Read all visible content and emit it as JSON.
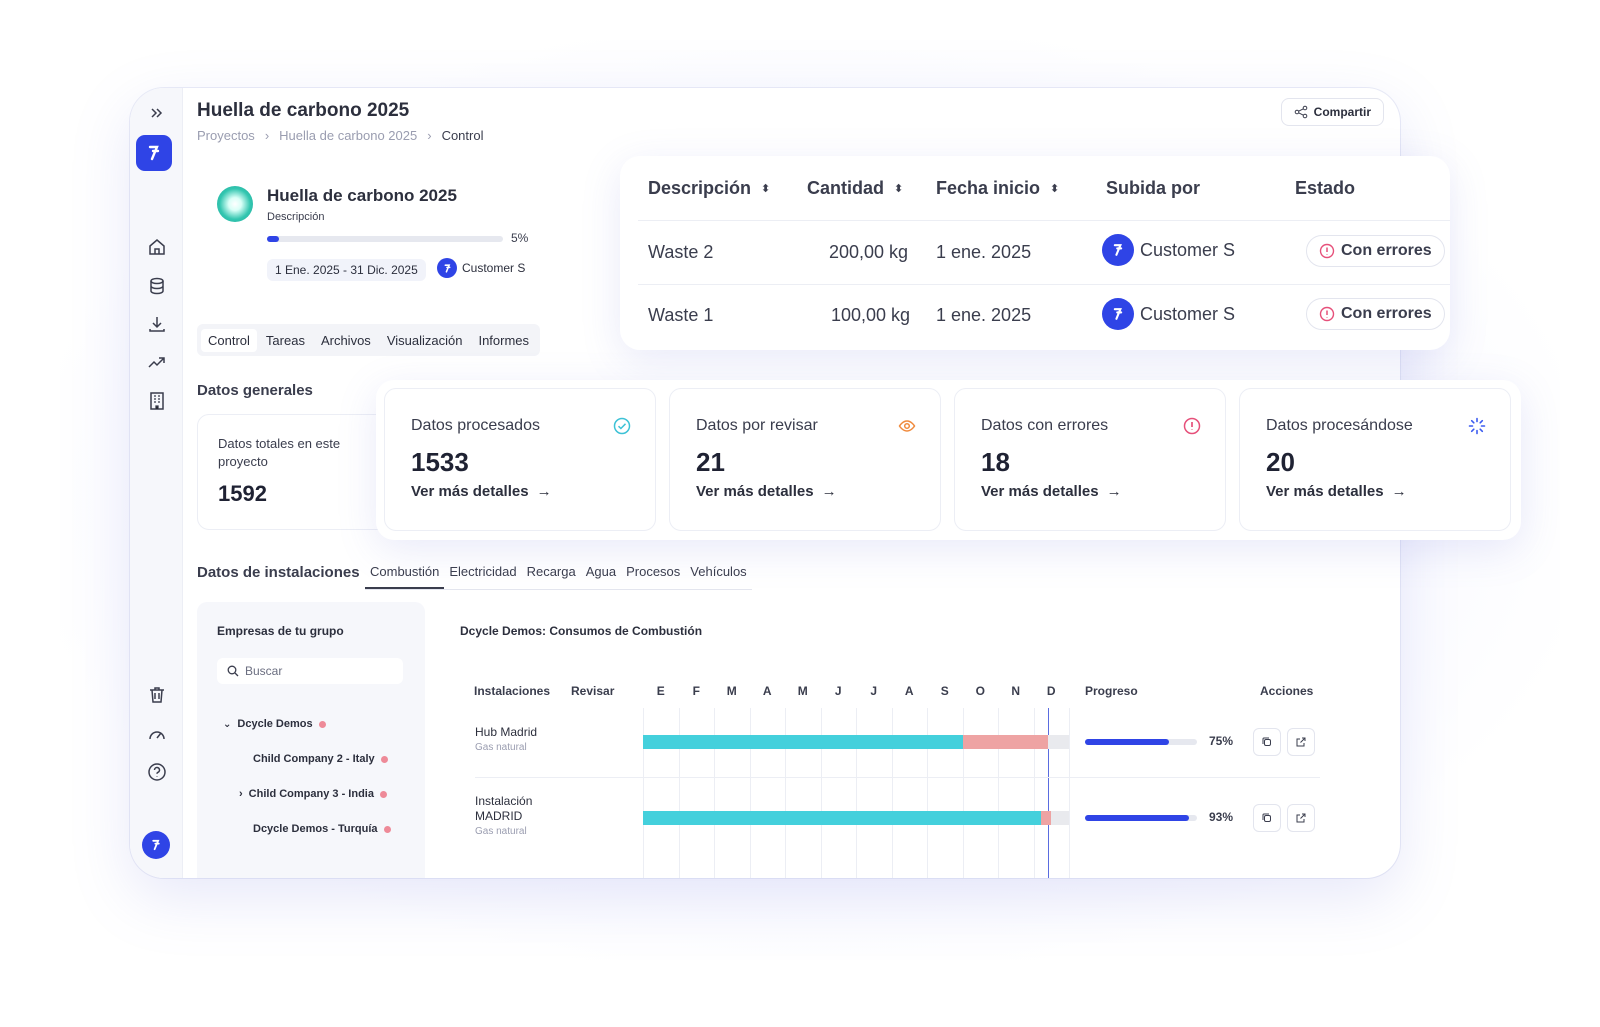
{
  "header": {
    "title": "Huella de carbono 2025",
    "breadcrumb": [
      "Proyectos",
      "Huella de carbono 2025",
      "Control"
    ],
    "share_label": "Compartir"
  },
  "project": {
    "name": "Huella de carbono 2025",
    "description": "Descripción",
    "progress_pct": 5,
    "progress_label": "5%",
    "dates": "1 Ene. 2025 - 31 Dic. 2025",
    "user": "Customer S"
  },
  "tabs": [
    "Control",
    "Tareas",
    "Archivos",
    "Visualización",
    "Informes"
  ],
  "general": {
    "title": "Datos generales",
    "total_label": "Datos totales en este proyecto",
    "total_value": "1592"
  },
  "stats": [
    {
      "title": "Datos procesados",
      "value": "1533",
      "link": "Ver más detalles",
      "icon": "check-circle-icon",
      "color": "#3dc2d6"
    },
    {
      "title": "Datos por revisar",
      "value": "21",
      "link": "Ver más detalles",
      "icon": "eye-icon",
      "color": "#f08a3c"
    },
    {
      "title": "Datos con errores",
      "value": "18",
      "link": "Ver más detalles",
      "icon": "alert-circle-icon",
      "color": "#e6507a"
    },
    {
      "title": "Datos procesándose",
      "value": "20",
      "link": "Ver más detalles",
      "icon": "spinner-icon",
      "color": "#3b5bf0"
    }
  ],
  "uploads": {
    "columns": [
      "Descripción",
      "Cantidad",
      "Fecha inicio",
      "Subida por",
      "Estado"
    ],
    "rows": [
      {
        "description": "Waste 2",
        "quantity": "200,00 kg",
        "date": "1 ene. 2025",
        "user": "Customer S",
        "status": "Con errores"
      },
      {
        "description": "Waste 1",
        "quantity": "100,00 kg",
        "date": "1 ene. 2025",
        "user": "Customer S",
        "status": "Con errores"
      }
    ]
  },
  "facilities": {
    "title": "Datos de instalaciones",
    "tabs": [
      "Combustión",
      "Electricidad",
      "Recarga",
      "Agua",
      "Procesos",
      "Vehículos"
    ],
    "group": {
      "title": "Empresas de tu grupo",
      "search_placeholder": "Buscar",
      "items": [
        "Dcycle Demos",
        "Child Company 2 - Italy",
        "Child Company 3 - India",
        "Dcycle Demos - Turquía"
      ]
    },
    "table_title": "Dcycle Demos: Consumos de Combustión",
    "columns": {
      "facilities": "Instalaciones",
      "review": "Revisar",
      "progress": "Progreso",
      "actions": "Acciones"
    },
    "months": [
      "E",
      "F",
      "M",
      "A",
      "M",
      "J",
      "J",
      "A",
      "S",
      "O",
      "N",
      "D"
    ],
    "rows": [
      {
        "name": "Hub Madrid",
        "type": "Gas natural",
        "complete_months": 9,
        "error_months": 2.4,
        "progress": 75,
        "progress_label": "75%"
      },
      {
        "name": "Instalación MADRID",
        "type": "Gas natural",
        "complete_months": 11.2,
        "error_months": 0.3,
        "progress": 93,
        "progress_label": "93%"
      }
    ]
  },
  "colors": {
    "accent": "#2f44e6",
    "complete": "#44d0dc",
    "error": "#eea3a3",
    "empty": "#e9eaee"
  }
}
